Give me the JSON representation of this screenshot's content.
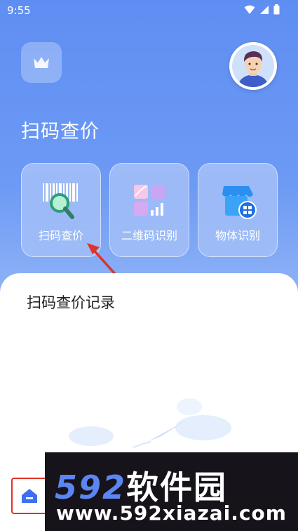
{
  "status": {
    "time": "9:55"
  },
  "header": {
    "title": "扫码查价"
  },
  "cards": [
    {
      "label": "扫码查价",
      "icon": "barcode-magnifier-icon"
    },
    {
      "label": "二维码识别",
      "icon": "qr-tiles-icon"
    },
    {
      "label": "物体识别",
      "icon": "shop-scan-icon"
    }
  ],
  "records": {
    "title": "扫码查价记录"
  },
  "watermark": {
    "brand_num": "592",
    "brand_cn": "软件园",
    "url": "www.592xiazai.com"
  },
  "colors": {
    "accent": "#5f8ef3",
    "annotation_red": "#e0332a",
    "watermark_bg": "#16131a"
  }
}
